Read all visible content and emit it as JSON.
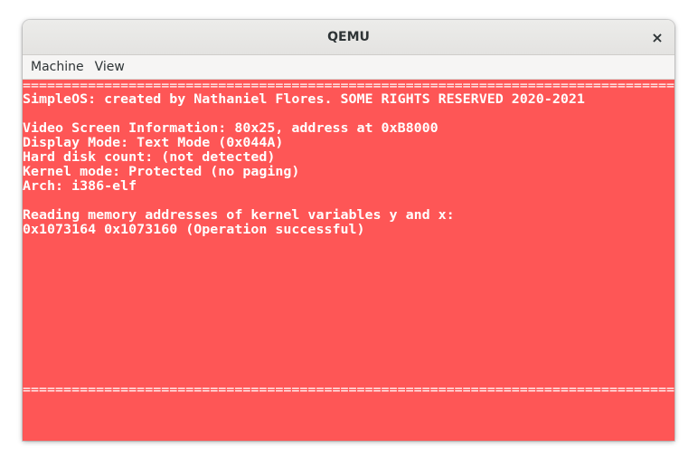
{
  "window": {
    "title": "QEMU",
    "close_glyph": "×"
  },
  "menu": {
    "items": [
      "Machine",
      "View"
    ]
  },
  "screen": {
    "background": "#fe5656",
    "text_color": "#ffffff",
    "divider_top": "================================================================================",
    "divider_bottom": "================================================================================",
    "lines": [
      "SimpleOS: created by Nathaniel Flores. SOME RIGHTS RESERVED 2020-2021",
      "",
      "Video Screen Information: 80x25, address at 0xB8000",
      "Display Mode: Text Mode (0x044A)",
      "Hard disk count: (not detected)",
      "Kernel mode: Protected (no paging)",
      "Arch: i386-elf",
      "",
      "Reading memory addresses of kernel variables y and x:",
      "0x1073164 0x1073160 (Operation successful)"
    ]
  }
}
